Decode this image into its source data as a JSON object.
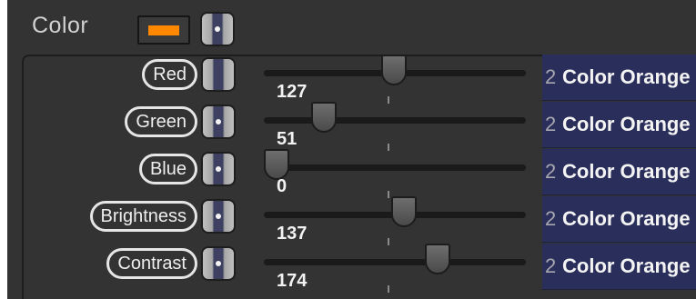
{
  "header": {
    "title": "Color",
    "swatch_color": "#ff8800"
  },
  "rows": [
    {
      "label": "Red",
      "value": "127",
      "level": 127,
      "cell_index": "2",
      "cell_name": "Color Orange",
      "knob": "plain"
    },
    {
      "label": "Green",
      "value": "51",
      "level": 51,
      "cell_index": "2",
      "cell_name": "Color Orange",
      "knob": "dot"
    },
    {
      "label": "Blue",
      "value": "0",
      "level": 0,
      "cell_index": "2",
      "cell_name": "Color Orange",
      "knob": "dot"
    },
    {
      "label": "Brightness",
      "value": "137",
      "level": 137,
      "cell_index": "2",
      "cell_name": "Color Orange",
      "knob": "dot"
    },
    {
      "label": "Contrast",
      "value": "174",
      "level": 174,
      "cell_index": "2",
      "cell_name": "Color Orange",
      "knob": "dot"
    }
  ],
  "slider_max": 255,
  "colors": {
    "panel_bg": "#333333",
    "color_cell_bg": "#2a2e5a",
    "accent_swatch": "#ff8800"
  },
  "icons": {
    "mapping_knob": "mapping-knob-icon",
    "swatch": "color-swatch"
  }
}
